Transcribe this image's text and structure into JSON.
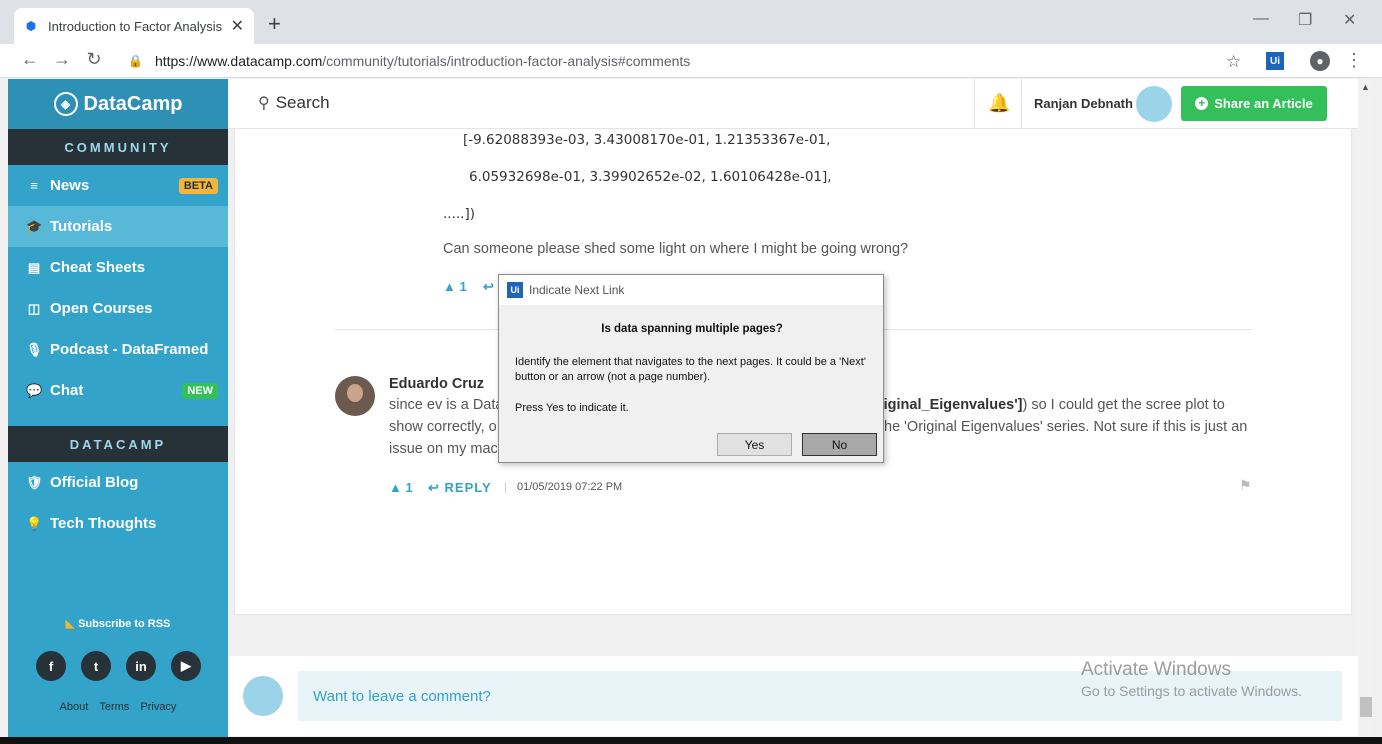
{
  "browser": {
    "tab_title": "Introduction to Factor Analysis in",
    "tab_close": "✕",
    "new_tab": "+",
    "url_host": "https://www.datacamp.com",
    "url_path": "/community/tutorials/introduction-factor-analysis#comments",
    "extension_label": "Ui"
  },
  "sidebar": {
    "brand": "DataCamp",
    "community_heading": "COMMUNITY",
    "community_items": [
      {
        "label": "News",
        "icon": "≡",
        "badge": "BETA"
      },
      {
        "label": "Tutorials",
        "icon": "🎓"
      },
      {
        "label": "Cheat Sheets",
        "icon": "▤"
      },
      {
        "label": "Open Courses",
        "icon": "◫"
      },
      {
        "label": "Podcast - DataFramed",
        "icon": "🎙"
      },
      {
        "label": "Chat",
        "icon": "💬",
        "badge": "NEW"
      }
    ],
    "datacamp_heading": "DATACAMP",
    "datacamp_items": [
      {
        "label": "Official Blog",
        "icon": "🛡"
      },
      {
        "label": "Tech Thoughts",
        "icon": "💡"
      }
    ],
    "rss": "Subscribe to RSS",
    "social": [
      "f",
      "t",
      "in",
      "▶"
    ],
    "footer": [
      "About",
      "Terms",
      "Privacy"
    ]
  },
  "header": {
    "search_label": "Search",
    "user_name": "Ranjan Debnath",
    "share_button": "Share an Article"
  },
  "content": {
    "code_line_1": "[-9.62088393e-03,  3.43008170e-01,  1.21353367e-01,",
    "code_line_2": "6.05932698e-01,  3.39902652e-02,  1.60106428e-01],",
    "code_line_3": ".....])",
    "question": "Can someone please shed some light on where I might be going wrong?",
    "upvote_1": "1",
    "comment_author": "Eduardo Cruz",
    "comment_line_1a": "since ev is a Data",
    "comment_line_1b_bold": "riginal_Eigenvalues']",
    "comment_line_1c": ") so I could get the scree plot to",
    "comment_line_2a": "show correctly, o",
    "comment_line_2b": "he 'Original Eigenvalues' series. Not sure if this is just an",
    "comment_line_3a": "issue on my mach",
    "upvote_2": "1",
    "reply_label": "REPLY",
    "comment_date": "01/05/2019 07:22 PM"
  },
  "bottom": {
    "leave_comment": "Want to leave a comment?"
  },
  "watermark": {
    "line1": "Activate Windows",
    "line2": "Go to Settings to activate Windows."
  },
  "dialog": {
    "title": "Indicate Next Link",
    "title_icon": "Ui",
    "question": "Is data spanning multiple pages?",
    "body": "Identify the element that navigates to the next pages. It could be a 'Next' button or an arrow (not a page number).",
    "press": "Press Yes to indicate it.",
    "yes": "Yes",
    "no": "No"
  }
}
